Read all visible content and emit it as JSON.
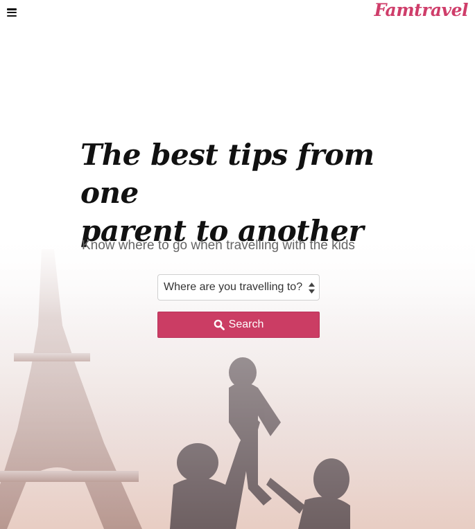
{
  "header": {
    "menu_icon": "hamburger-menu-icon",
    "logo_text": "Famtravel"
  },
  "hero": {
    "title_line1": "The best tips from one",
    "title_line2": "parent to another",
    "subtitle": "Know where to go when travelling with the kids",
    "background_image": "family-eiffel-tower-photo"
  },
  "search": {
    "select_value": "Where are you travelling to?",
    "select_icon": "updown-arrows-icon",
    "button_label": "Search",
    "button_icon": "search-icon"
  },
  "colors": {
    "brand": "#cf3d6a",
    "button": "#cb3d64"
  }
}
